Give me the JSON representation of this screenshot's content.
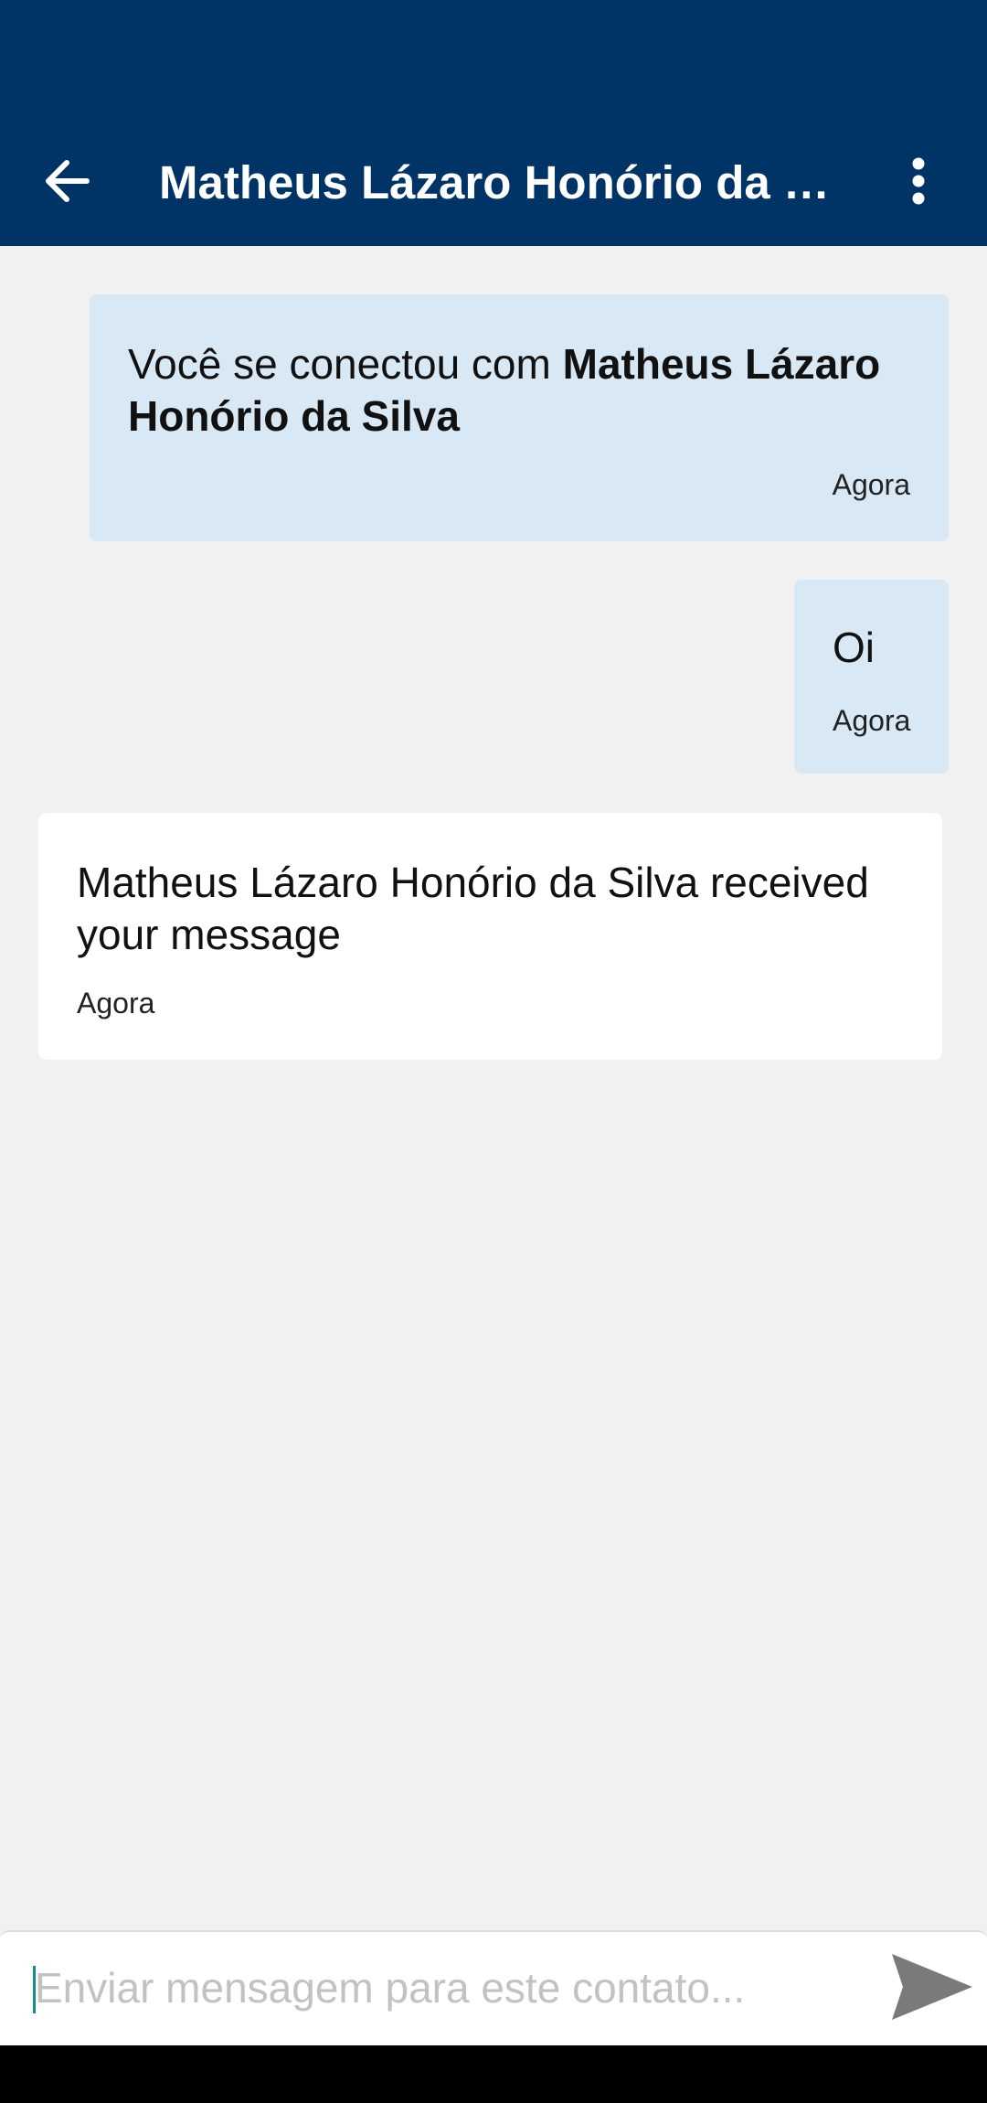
{
  "header": {
    "title": "Matheus Lázaro Honório da Silva",
    "back_icon": "arrow-left-icon",
    "menu_icon": "more-vertical-icon",
    "background_color": "#003366"
  },
  "messages": [
    {
      "type": "system",
      "text_prefix": "Você se conectou com ",
      "text_bold": "Matheus Lázaro Honório da Silva",
      "time": "Agora"
    },
    {
      "type": "outgoing",
      "text": "Oi",
      "time": "Agora"
    },
    {
      "type": "incoming",
      "text": "Matheus Lázaro Honório da Silva received your message",
      "time": "Agora"
    }
  ],
  "composer": {
    "placeholder": "Enviar mensagem para este contato...",
    "value": "",
    "send_icon": "send-icon"
  },
  "colors": {
    "chat_background": "#f1f1f1",
    "outgoing_bubble": "#d8e8f4",
    "incoming_bubble": "#ffffff"
  }
}
